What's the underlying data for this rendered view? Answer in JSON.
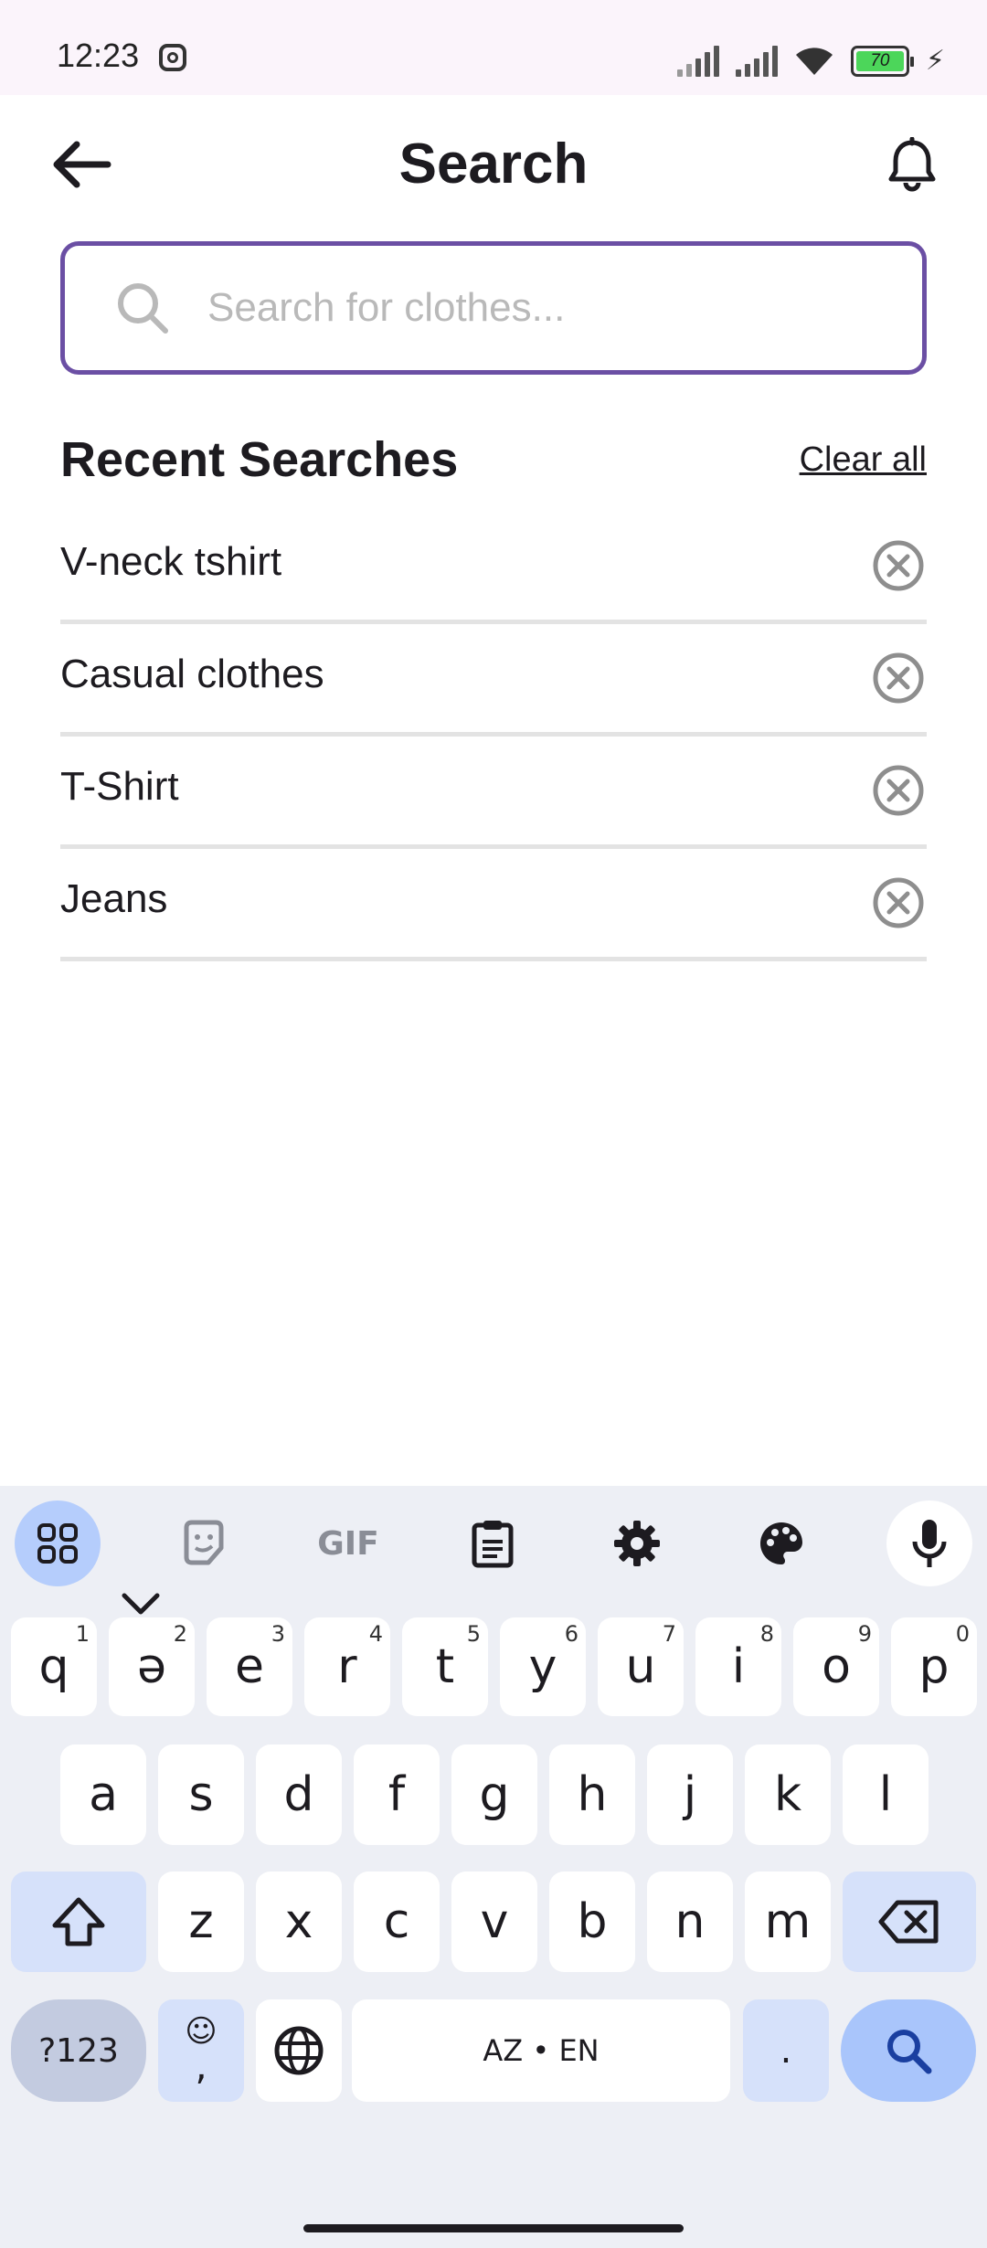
{
  "status_bar": {
    "time": "12:23",
    "battery_level": "70"
  },
  "header": {
    "title": "Search"
  },
  "search": {
    "placeholder": "Search for clothes...",
    "value": ""
  },
  "recent": {
    "title": "Recent Searches",
    "clear_label": "Clear all",
    "items": [
      {
        "label": "V-neck tshirt"
      },
      {
        "label": "Casual clothes"
      },
      {
        "label": "T-Shirt"
      },
      {
        "label": "Jeans"
      }
    ]
  },
  "colors": {
    "accent": "#6b4fa4",
    "divider": "#e3e3e3",
    "keyboard_bg": "#edeff5"
  },
  "keyboard": {
    "toolbar": {
      "gif_label": "GIF",
      "icons": [
        "apps-grid-icon",
        "sticker-icon",
        "gif-icon",
        "clipboard-icon",
        "settings-gear-icon",
        "palette-icon",
        "microphone-icon"
      ]
    },
    "row1": [
      {
        "key": "q",
        "hint": "1"
      },
      {
        "key": "ə",
        "hint": "2"
      },
      {
        "key": "e",
        "hint": "3"
      },
      {
        "key": "r",
        "hint": "4"
      },
      {
        "key": "t",
        "hint": "5"
      },
      {
        "key": "y",
        "hint": "6"
      },
      {
        "key": "u",
        "hint": "7"
      },
      {
        "key": "i",
        "hint": "8"
      },
      {
        "key": "o",
        "hint": "9"
      },
      {
        "key": "p",
        "hint": "0"
      }
    ],
    "row2": [
      "a",
      "s",
      "d",
      "f",
      "g",
      "h",
      "j",
      "k",
      "l"
    ],
    "row3": [
      "z",
      "x",
      "c",
      "v",
      "b",
      "n",
      "m"
    ],
    "symbols_label": "?123",
    "emoji_comma_label": ",",
    "space_label": "AZ • EN",
    "period_label": "."
  }
}
